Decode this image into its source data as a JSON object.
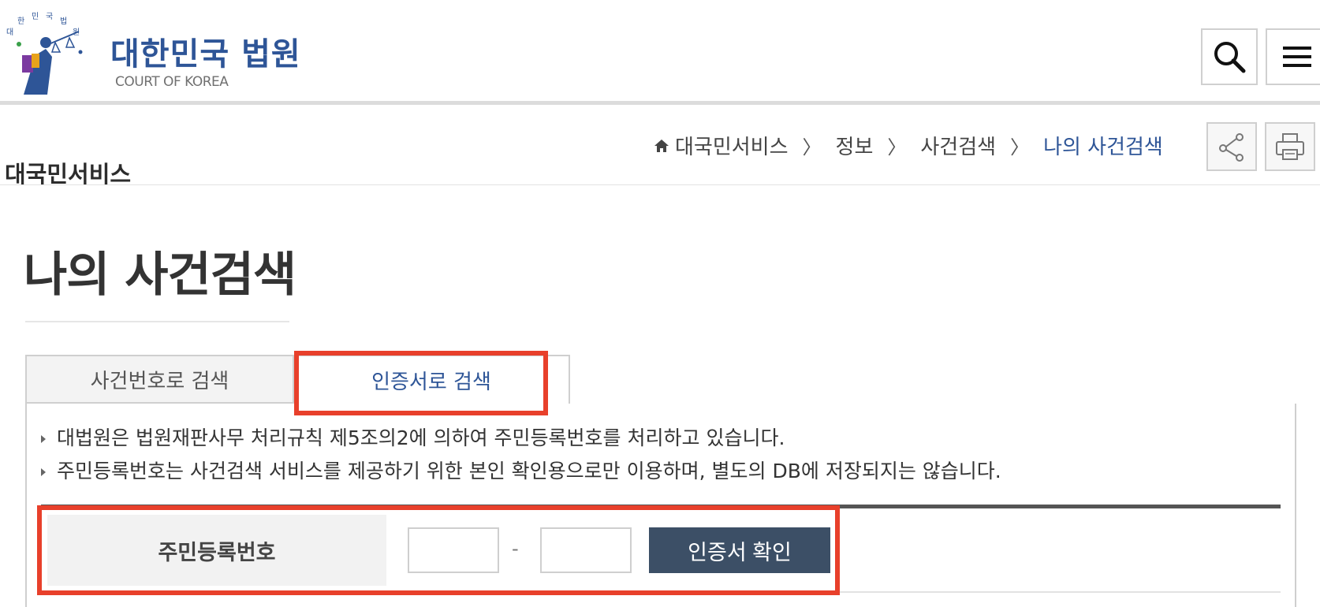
{
  "header": {
    "title": "대한민국 법원",
    "subtitle": "COURT OF KOREA",
    "logo_icon": "court-emblem-icon",
    "search_icon": "search-icon",
    "menu_icon": "hamburger-menu-icon"
  },
  "subheader": {
    "section_name": "대국민서비스",
    "breadcrumb": [
      "대국민서비스",
      "정보",
      "사건검색",
      "나의 사건검색"
    ],
    "breadcrumb_separator": "〉",
    "share_icon": "share-icon",
    "print_icon": "print-icon"
  },
  "page": {
    "title": "나의 사건검색"
  },
  "tabs": [
    {
      "label": "사건번호로 검색",
      "active": false
    },
    {
      "label": "인증서로 검색",
      "active": true
    }
  ],
  "notices": [
    "대법원은 법원재판사무 처리규칙 제5조의2에 의하여 주민등록번호를 처리하고 있습니다.",
    "주민등록번호는 사건검색 서비스를 제공하기 위한 본인 확인용으로만 이용하며, 별도의 DB에 저장되지는 않습니다."
  ],
  "form": {
    "label": "주민등록번호",
    "ssn_first_value": "",
    "ssn_second_value": "",
    "dash": "-",
    "verify_button": "인증서 확인"
  },
  "colors": {
    "brand": "#2e5597",
    "button": "#3c4f66",
    "highlight": "#e8402b"
  }
}
